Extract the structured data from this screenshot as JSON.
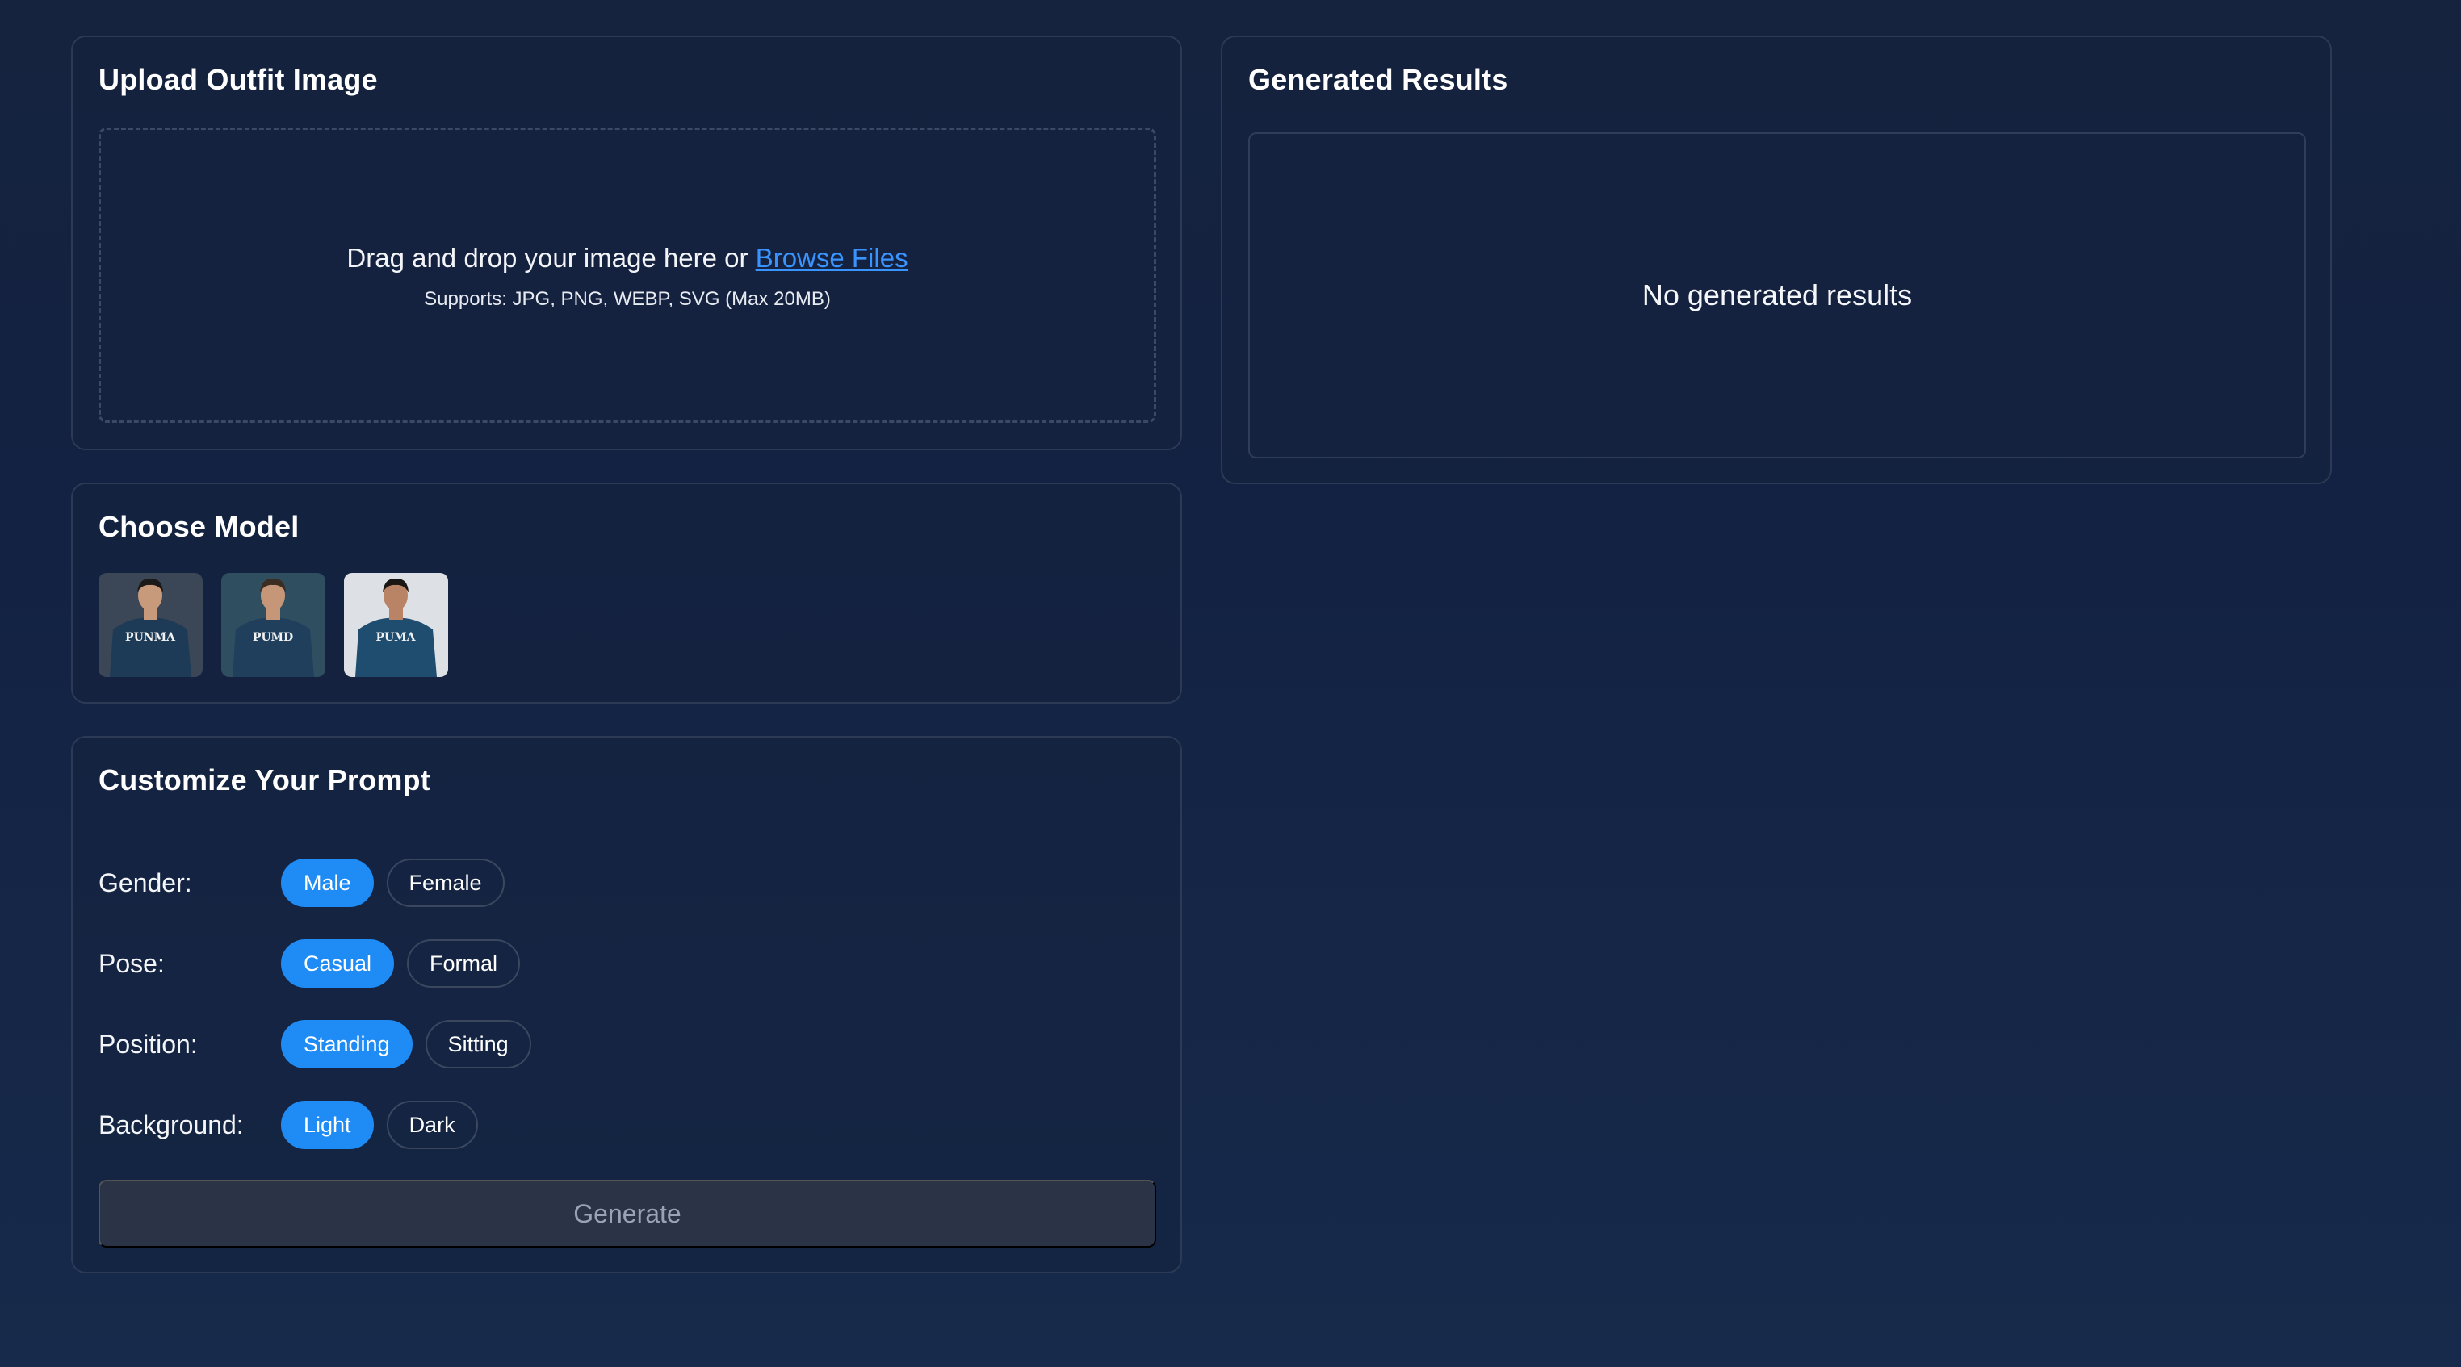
{
  "upload": {
    "title": "Upload Outfit Image",
    "drop_text": "Drag and drop your image here or ",
    "browse_link": "Browse Files",
    "supports": "Supports: JPG, PNG, WEBP, SVG (Max 20MB)"
  },
  "models": {
    "title": "Choose Model",
    "items": [
      {
        "shirt_text": "PUNMA",
        "bg": "#3b4656",
        "shirt": "#1d3b57",
        "skin": "#c79a7c",
        "hair": "#1c1a18"
      },
      {
        "shirt_text": "PUMD",
        "bg": "#2f4e60",
        "shirt": "#1f3f5c",
        "skin": "#c59778",
        "hair": "#3c2d22"
      },
      {
        "shirt_text": "PUMA",
        "bg": "#dde1e6",
        "shirt": "#1f4d6f",
        "skin": "#b98465",
        "hair": "#1a1614"
      }
    ]
  },
  "prompt": {
    "title": "Customize Your Prompt",
    "rows": [
      {
        "label": "Gender:",
        "options": [
          "Male",
          "Female"
        ],
        "selected": "Male"
      },
      {
        "label": "Pose:",
        "options": [
          "Casual",
          "Formal"
        ],
        "selected": "Casual"
      },
      {
        "label": "Position:",
        "options": [
          "Standing",
          "Sitting"
        ],
        "selected": "Standing"
      },
      {
        "label": "Background:",
        "options": [
          "Light",
          "Dark"
        ],
        "selected": "Light"
      }
    ],
    "generate_label": "Generate"
  },
  "results": {
    "title": "Generated Results",
    "empty_text": "No generated results"
  },
  "colors": {
    "accent": "#1f8bf5",
    "link": "#3a94ff"
  }
}
